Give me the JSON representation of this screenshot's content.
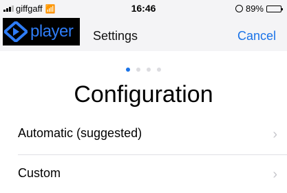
{
  "status_bar": {
    "carrier": "giffgaff",
    "time": "16:46",
    "battery_percent": "89%",
    "battery_level": 0.89
  },
  "nav": {
    "logo_text": "player",
    "title": "Settings",
    "cancel_label": "Cancel",
    "accent_color": "#1a73e8"
  },
  "pager": {
    "total": 4,
    "active_index": 0
  },
  "main": {
    "heading": "Configuration",
    "options": [
      {
        "label": "Automatic (suggested)",
        "icon": "chevron-right-icon"
      },
      {
        "label": "Custom",
        "icon": "chevron-right-icon"
      }
    ]
  }
}
